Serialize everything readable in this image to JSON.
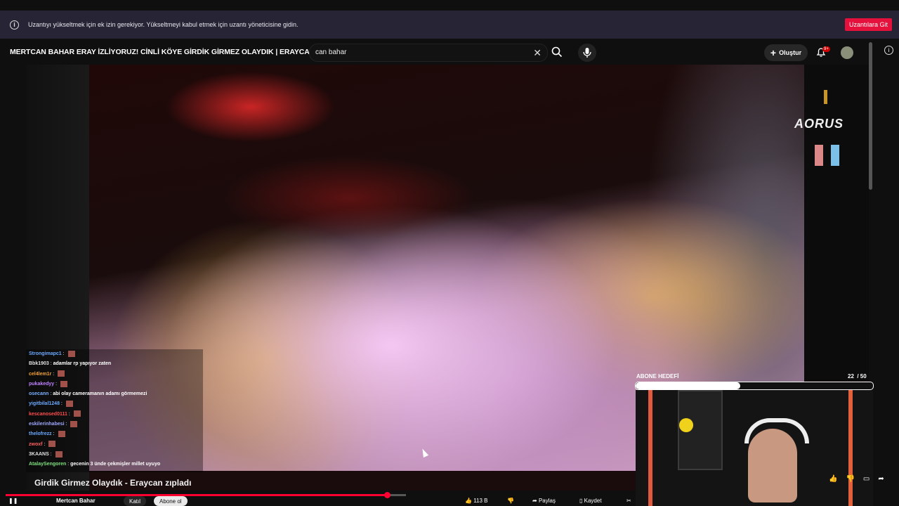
{
  "infobar": {
    "message": "Uzantıyı yükseltmek için ek izin gerekiyor. Yükseltmeyi kabul etmek için uzantı yöneticisine gidin.",
    "button": "Uzantılara Git",
    "icon": "info-icon"
  },
  "header": {
    "video_title": "MERTCAN BAHAR ERAY İZLİYORUZ! CİNLİ KÖYE GİRDİK GİRMEZ OLAYDIK | ERAYCAN ZIPLADI",
    "search_value": "can bahar",
    "create_label": "Oluştur",
    "notification_count": "9+"
  },
  "overlay": {
    "sub_goal_label": "ABONE HEDEFİ",
    "sub_goal_current": "22",
    "sub_goal_target": "/ 50",
    "sub_goal_fraction": 0.44,
    "brand": "AORUS"
  },
  "chat": [
    {
      "user": "Strongimapc1",
      "msg": "",
      "color": "#6aa9ff"
    },
    {
      "user": "Bbk1903",
      "msg": "adamlar rp yapıyor zaten",
      "color": "#e0e0e0"
    },
    {
      "user": "cel4lem1r",
      "msg": "",
      "color": "#f0a030"
    },
    {
      "user": "pukakedyy",
      "msg": "",
      "color": "#c080ff"
    },
    {
      "user": "osecann",
      "msg": "abi olay cameramanın adamı görmemezi",
      "color": "#7ab0ff"
    },
    {
      "user": "yigitbilal1248",
      "msg": "",
      "color": "#6aa9ff"
    },
    {
      "user": "kescanosed0111",
      "msg": "",
      "color": "#ff4d4d"
    },
    {
      "user": "eskilerinhabesi",
      "msg": "",
      "color": "#9fa8ff"
    },
    {
      "user": "thelofrezz",
      "msg": "",
      "color": "#6aa9ff"
    },
    {
      "user": "zwoxf",
      "msg": "",
      "color": "#ff6060"
    },
    {
      "user": "3KAANS",
      "msg": "",
      "color": "#e0e0e0"
    },
    {
      "user": "AtalaySengoren",
      "msg": "gecenin 3 ünde çekmişler millet uyuyo",
      "color": "#7ee07e"
    }
  ],
  "player": {
    "subtitle": "Girdik Girmez Olaydık - Eraycan zıpladı",
    "progress_fraction": 0.95
  },
  "bottom": {
    "channel": "Mertcan Bahar",
    "join_label": "Katıl",
    "subscribe_label": "Abone ol",
    "like_count": "113 B",
    "share_label": "Paylaş",
    "save_label": "Kaydet"
  }
}
